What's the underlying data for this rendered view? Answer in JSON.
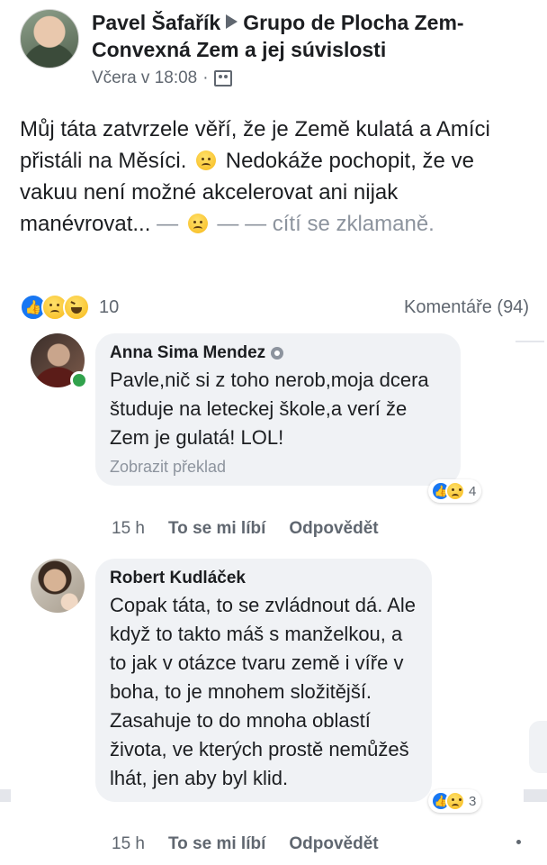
{
  "post": {
    "author": "Pavel Šafařík",
    "group": "Grupo de Plocha Zem-",
    "group_line2": "Convexná Zem a jej súvislosti",
    "timestamp": "Včera v 18:08",
    "separator": "·",
    "audience_icon": "group-icon",
    "body_part1": "Můj táta zatvrzele věří, že je Země kulatá a Amíci přistáli na Měsíci.",
    "body_part2": "Nedokáže pochopit, že ve vakuu není možné akcelerovat ani nijak manévrovat...",
    "feeling_dash1": "—",
    "feeling_dash2": "— —",
    "feeling_text": "cítí se zklamaně.",
    "reactions": [
      "like",
      "sad",
      "haha"
    ],
    "reaction_count": "10",
    "comments_label": "Komentáře (94)"
  },
  "comments": [
    {
      "author": "Anna Sima Mendez",
      "text": "Pavle,nič si z toho nerob,moja dcera študuje na leteckej škole,a verí že Zem je gulatá! LOL!",
      "translate": "Zobrazit překlad",
      "reactions": [
        "like",
        "sad"
      ],
      "reaction_count": "4",
      "time": "15 h",
      "like_label": "To se mi líbí",
      "reply_label": "Odpovědět"
    },
    {
      "author": "Robert Kudláček",
      "text": "Copak táta, to se zvládnout dá. Ale když to takto máš s manželkou, a to jak v otázce tvaru země i víře v boha, to je mnohem složitější. Zasahuje to do mnoha oblastí života, ve kterých prostě nemůžeš lhát, jen aby byl klid.",
      "reactions": [
        "like",
        "sad"
      ],
      "reaction_count": "3",
      "time": "15 h",
      "like_label": "To se mi líbí",
      "reply_label": "Odpovědět"
    }
  ],
  "colors": {
    "text": "#1c1e21",
    "secondary": "#606770",
    "muted": "#8d949e",
    "bubble": "#f0f2f5",
    "like_blue": "#1877f2",
    "online_green": "#31a24c"
  }
}
